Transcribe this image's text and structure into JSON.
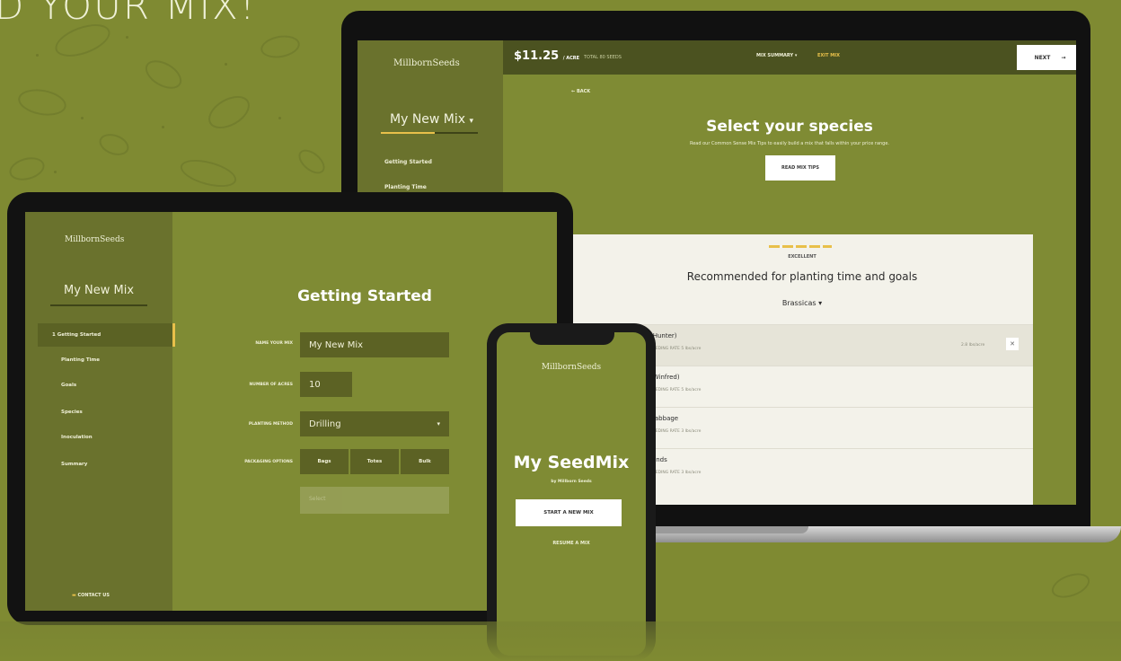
{
  "headline": "D YOUR MIX!",
  "brand": "MillbornSeeds",
  "laptop": {
    "price": "$11.25",
    "price_unit": "/ ACRE",
    "total_seeds": "TOTAL 80 SEEDS",
    "mix_summary": "MIX SUMMARY",
    "exit": "EXIT MIX",
    "next": "NEXT",
    "back": "BACK",
    "mix_name": "My New Mix",
    "nav": [
      "Getting Started",
      "Planting Time"
    ],
    "title": "Select your species",
    "subtitle": "Read our Common Sense Mix Tips to easily build a mix that falls within your price range.",
    "tips_button": "READ MIX TIPS",
    "rating": "EXCELLENT",
    "recommended": "Recommended for planting time and goals",
    "category": "Brassicas",
    "rows": [
      {
        "name": "(Hunter)",
        "rate": "SEEDING RATE",
        "rate_val": "5 lbs/acre",
        "qty": "2.8 lbs/acre",
        "active": true
      },
      {
        "name": "(Winfred)",
        "rate": "SEEDING RATE",
        "rate_val": "5 lbs/acre"
      },
      {
        "name": "Cabbage",
        "rate": "SEEDING RATE",
        "rate_val": "3 lbs/acre"
      },
      {
        "name": "lands",
        "rate": "SEEDING RATE",
        "rate_val": "3 lbs/acre"
      }
    ]
  },
  "tablet": {
    "mix_name": "My New Mix",
    "title": "Getting Started",
    "nav": [
      "1  Getting Started",
      "Planting Time",
      "Goals",
      "Species",
      "Inoculation",
      "Summary"
    ],
    "labels": {
      "name": "NAME YOUR MIX",
      "acres": "NUMBER OF ACRES",
      "method": "PLANTING METHOD",
      "packaging": "PACKAGING OPTIONS"
    },
    "values": {
      "name": "My New Mix",
      "acres": "10",
      "method": "Drilling"
    },
    "packaging_options": [
      "Bags",
      "Totes",
      "Bulk"
    ],
    "disabled_placeholder": "Select",
    "contact": "CONTACT US"
  },
  "phone": {
    "title": "My SeedMix",
    "by": "by Millborn Seeds",
    "start": "START A NEW MIX",
    "resume": "RESUME A MIX"
  },
  "colors": {
    "background": "#7f8a32",
    "sidebar": "#6a722d",
    "accent": "#e8c04a",
    "topbar": "#4b5220"
  }
}
